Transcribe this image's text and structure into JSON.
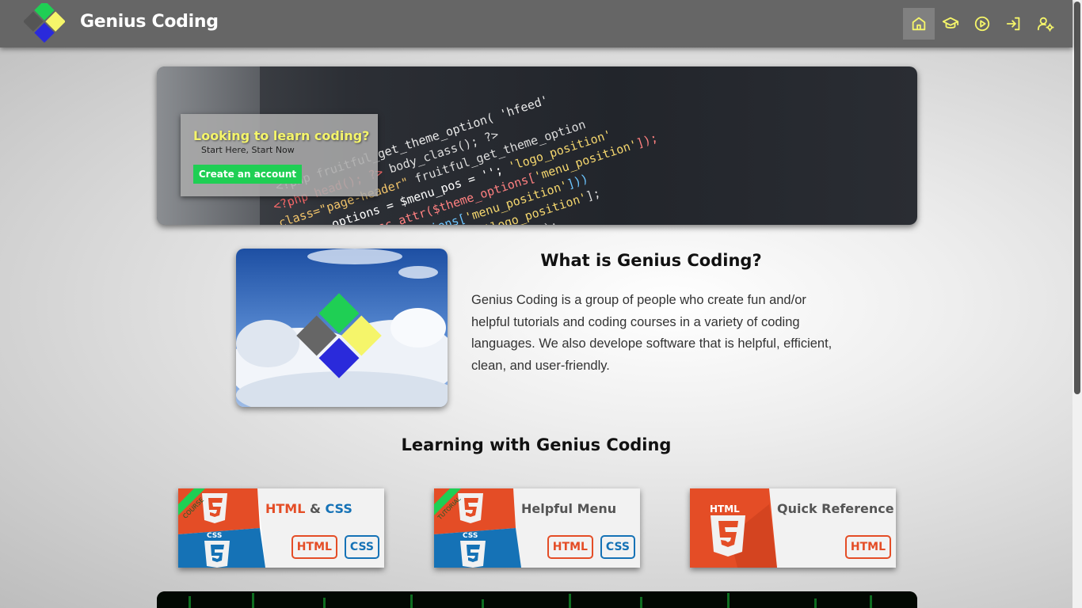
{
  "navbar": {
    "brand": "Genius Coding",
    "icons": [
      "home-icon",
      "graduation-cap-icon",
      "play-circle-icon",
      "login-icon",
      "user-settings-icon"
    ],
    "icon_color": "#f5f56a",
    "bg_color": "#666666"
  },
  "hero": {
    "title": "Looking to learn coding?",
    "subtitle": "Start Here, Start Now",
    "button": "Create an account",
    "button_color": "#1fcf54",
    "title_color": "#f5f56a"
  },
  "about": {
    "title": "What is Genius Coding?",
    "text": "Genius Coding is a group of people who create fun and/or helpful tutorials and coding courses in a variety of coding languages. We also develope software that is helpful, efficient, clean, and user-friendly."
  },
  "learning": {
    "title": "Learning with Genius Coding",
    "cards": [
      {
        "ribbon": "COURSE",
        "title_html": "HTML",
        "title_amp": " & ",
        "title_css": "CSS",
        "tags": [
          "HTML",
          "CSS"
        ]
      },
      {
        "ribbon": "TUTORIAL",
        "title": "Helpful Menu",
        "tags": [
          "HTML",
          "CSS"
        ]
      },
      {
        "title": "Quick Reference",
        "tags": [
          "HTML"
        ]
      }
    ]
  },
  "colors": {
    "html": "#e44d26",
    "css": "#1572b6",
    "green": "#1fcf54"
  },
  "logo_text": {
    "html5": "HTML",
    "css3": "CSS"
  }
}
